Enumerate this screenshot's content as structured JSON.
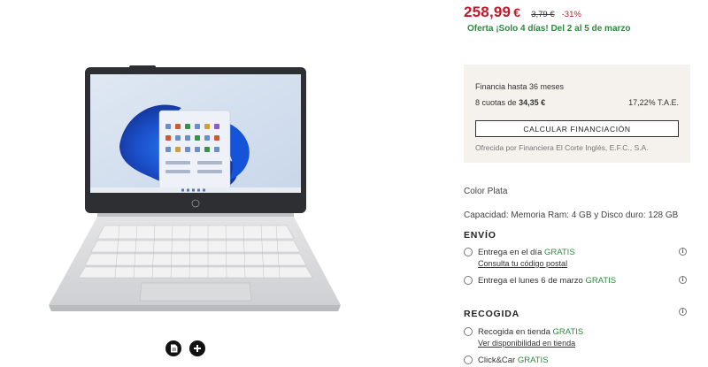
{
  "price": {
    "current_int": "258,99",
    "currency": "€",
    "old": "3,79 €",
    "discount": "-31%"
  },
  "offer": "Oferta ¡Solo 4 días! Del 2 al 5 de marzo",
  "financing": {
    "title": "Financia hasta 36 meses",
    "quota_prefix": "8 cuotas de",
    "quota_amount": "34,35 €",
    "tae": "17,22% T.A.E.",
    "button": "CALCULAR FINANCIACIÓN",
    "note": "Ofrecida por Financiera El Corte Inglés, E.F.C., S.A."
  },
  "attributes": {
    "color": "Color Plata",
    "capacity": "Capacidad: Memoria Ram: 4 GB y Disco duro: 128 GB"
  },
  "shipping": {
    "title": "ENVÍO",
    "options": [
      {
        "label": "Entrega en el día",
        "free": "GRATIS",
        "link": "Consulta tu código postal"
      },
      {
        "label": "Entrega el lunes 6 de marzo",
        "free": "GRATIS"
      }
    ]
  },
  "pickup": {
    "title": "RECOGIDA",
    "options": [
      {
        "label": "Recogida en tienda",
        "free": "GRATIS",
        "link": "Ver disponibilidad en tienda"
      },
      {
        "label": "Click&Car",
        "free": "GRATIS"
      }
    ]
  },
  "icons": {
    "info": "info-icon",
    "sheet": "document-icon",
    "add": "plus-icon"
  },
  "colors": {
    "price_red": "#c4182b",
    "offer_green": "#2b8a3e",
    "finance_bg": "#f5f2ee"
  }
}
